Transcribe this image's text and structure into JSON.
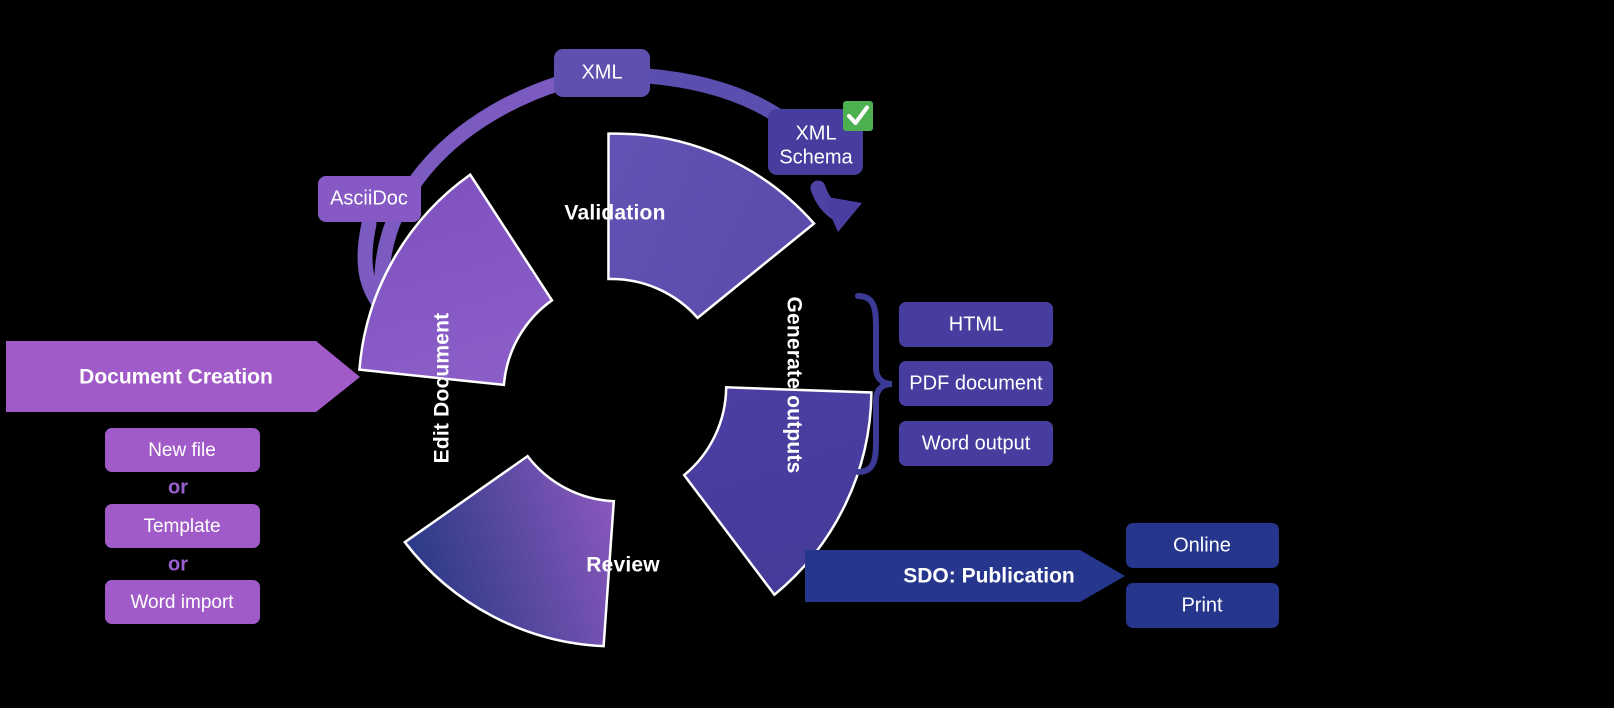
{
  "diagram": {
    "title": "Document lifecycle wheel",
    "background_color": "#000000"
  },
  "wheel": {
    "segments": [
      {
        "id": "validation",
        "label": "Validation",
        "color": "#5f50b0"
      },
      {
        "id": "generate",
        "label": "Generate outputs",
        "color": "#473d9e"
      },
      {
        "id": "review",
        "label": "Review",
        "color_start": "#8a58bd",
        "color_end": "#2a3a86"
      },
      {
        "id": "edit",
        "label": "Edit Document",
        "color": "#8659c4"
      }
    ]
  },
  "inputs": {
    "banner": {
      "label": "Document Creation",
      "color": "#a15bc8"
    },
    "options": [
      {
        "label": "New file",
        "color": "#a15bc8"
      },
      {
        "label": "Template",
        "color": "#a15bc8"
      },
      {
        "label": "Word import",
        "color": "#a15bc8"
      }
    ],
    "separators": [
      {
        "label": "or",
        "color": "#9b5fd0"
      },
      {
        "label": "or",
        "color": "#9b5fd0"
      }
    ]
  },
  "formats": {
    "asciidoc": {
      "label": "AsciiDoc",
      "color": "#8659c4"
    },
    "xml": {
      "label": "XML",
      "color": "#5f50b0"
    },
    "xml_schema": {
      "label": "XML Schema",
      "label_line1": "XML",
      "label_line2": "Schema",
      "color": "#473d9e"
    },
    "validated_badge": {
      "icon": "check-mark-icon",
      "glyph": "✔",
      "color": "#4caf50"
    },
    "arc_color": "#7b5bc0"
  },
  "outputs": {
    "brace_color": "#3b3a97",
    "items": [
      {
        "label": "HTML",
        "color": "#473d9e"
      },
      {
        "label": "PDF document",
        "color": "#473d9e"
      },
      {
        "label": "Word output",
        "color": "#473d9e"
      }
    ]
  },
  "publication": {
    "banner": {
      "label": "SDO: Publication",
      "color": "#26368c"
    },
    "channels": [
      {
        "label": "Online",
        "color": "#26368c"
      },
      {
        "label": "Print",
        "color": "#26368c"
      }
    ]
  }
}
